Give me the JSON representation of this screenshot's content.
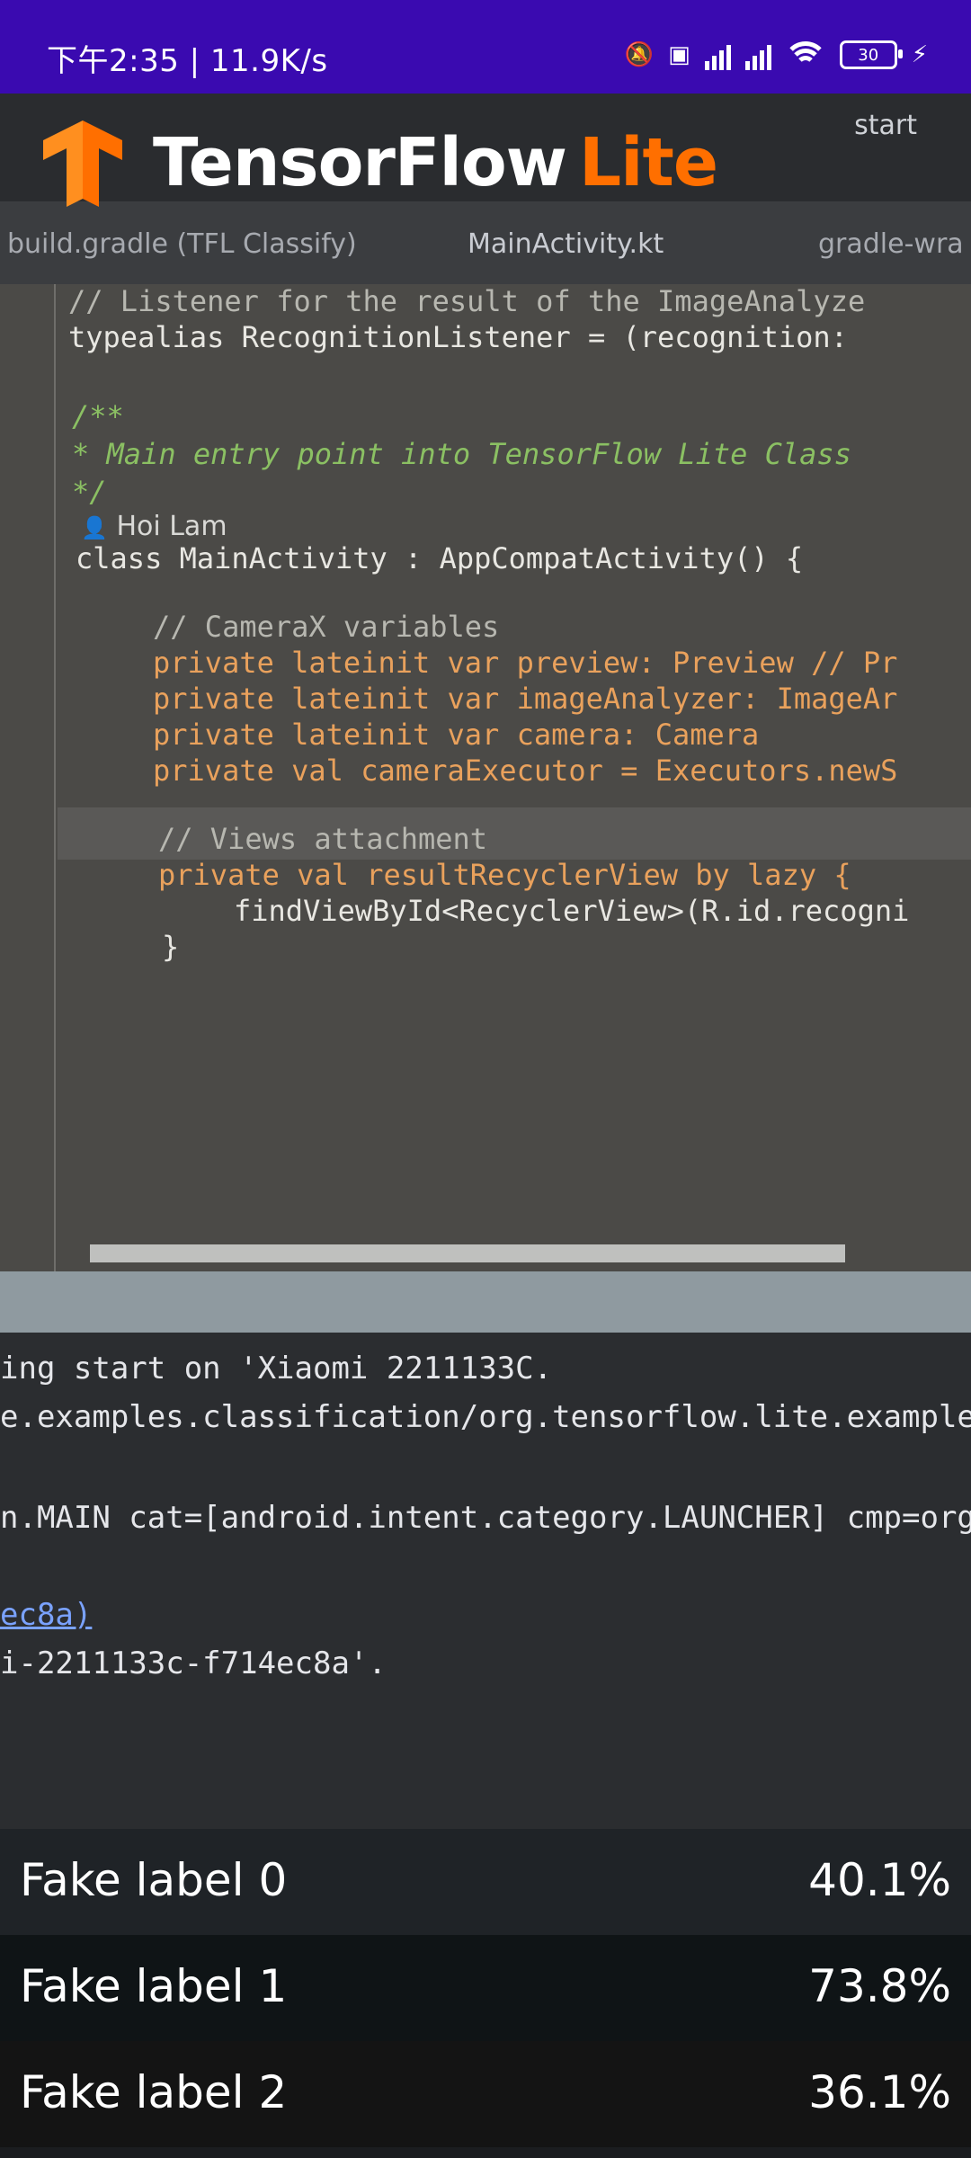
{
  "status_bar": {
    "time_speed": "下午2:35 | 11.9K/s",
    "battery": "30"
  },
  "logo": {
    "text_main": "TensorFlow",
    "text_accent": "Lite"
  },
  "ide": {
    "tabs": [
      "build.gradle (TFL Classify)",
      "MainActivity.kt",
      "gradle-wra"
    ],
    "toolbar_run": "start",
    "code_lines": [
      "// Listener for the result of the ImageAnalyze",
      "typealias RecognitionListener = (recognition:",
      "/**",
      " * Main entry point into TensorFlow Lite Class",
      " */",
      "class MainActivity : AppCompatActivity() {",
      "// CameraX variables",
      "private lateinit var preview: Preview // Pr",
      "private lateinit var imageAnalyzer: ImageAr",
      "private lateinit var camera: Camera",
      "private val cameraExecutor = Executors.newS",
      "// Views attachment",
      "private val resultRecyclerView by lazy {",
      "findViewById<RecyclerView>(R.id.recogni",
      "}"
    ],
    "author": "Hoi Lam",
    "console_lines": [
      "ing start on 'Xiaomi 2211133C.",
      "e.examples.classification/org.tensorflow.lite.example",
      "n.MAIN cat=[android.intent.category.LAUNCHER] cmp=org",
      "ec8a)",
      "i-2211133c-f714ec8a'."
    ]
  },
  "results": [
    {
      "label": "Fake label 0",
      "percent": "40.1%"
    },
    {
      "label": "Fake label 1",
      "percent": "73.8%"
    },
    {
      "label": "Fake label 2",
      "percent": "36.1%"
    }
  ],
  "colors": {
    "status_bar": "#3a0ab0",
    "tf_orange": "#ff6f00",
    "result_row_1": "#1f2327",
    "result_row_2": "#0f1416",
    "result_row_3": "#141414"
  }
}
